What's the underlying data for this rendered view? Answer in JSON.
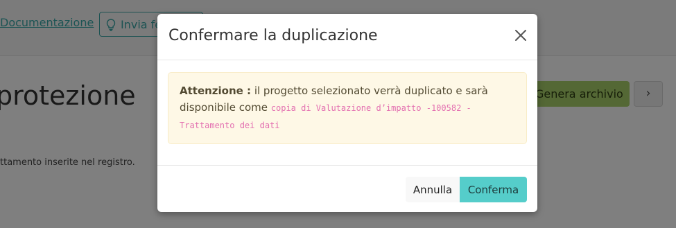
{
  "background": {
    "doc_link": "Documentazione",
    "feedback_button": "Invia feedback",
    "page_heading": "protezione",
    "subtext": "ttamento inserite nel registro.",
    "genera_button": "Genera archivio",
    "next_button_icon": "chevron-right-icon"
  },
  "modal": {
    "title": "Confermare la duplicazione",
    "close_icon": "close-icon",
    "alert": {
      "label": "Attenzione :",
      "message": " il progetto selezionato verrà duplicato e sarà disponibile come ",
      "code": "copia di Valutazione d’impatto -100582 - Trattamento dei dati"
    },
    "buttons": {
      "cancel": "Annulla",
      "confirm": "Conferma"
    }
  },
  "colors": {
    "confirm_button": "#55cdca",
    "alert_background": "#fef8e6",
    "code_text": "#e36fb0",
    "genera_button": "#a9d06b",
    "link": "#38a8a8"
  }
}
